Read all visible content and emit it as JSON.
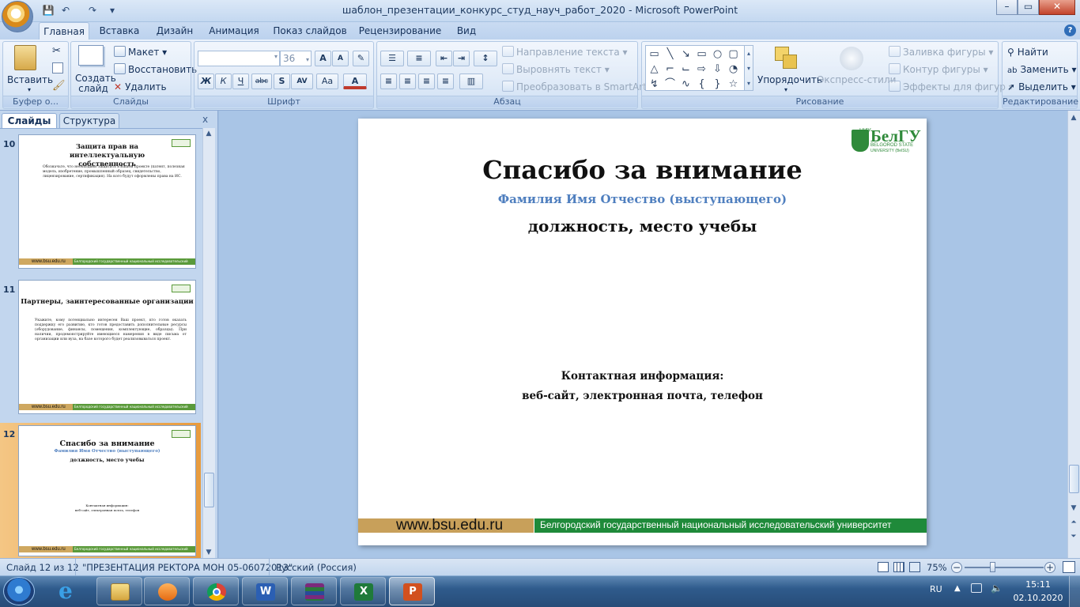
{
  "window": {
    "title": "шаблон_презентации_конкурс_студ_науч_работ_2020 - Microsoft PowerPoint",
    "minimize": "–",
    "maximize": "▭",
    "close": "✕"
  },
  "qat": {
    "save": "💾",
    "undo": "↶",
    "redo": "↷",
    "customize": "▾"
  },
  "tabs": [
    "Главная",
    "Вставка",
    "Дизайн",
    "Анимация",
    "Показ слайдов",
    "Рецензирование",
    "Вид"
  ],
  "help": "?",
  "ribbon": {
    "clipboard": {
      "label": "Буфер о...",
      "paste": "Вставить"
    },
    "slides": {
      "label": "Слайды",
      "new_slide": "Создать слайд",
      "layout": "Макет",
      "reset": "Восстановить",
      "delete": "Удалить"
    },
    "font": {
      "label": "Шрифт",
      "font_name": "",
      "font_size": "36",
      "grow": "A",
      "shrink": "A",
      "bold": "Ж",
      "italic": "К",
      "underline": "Ч",
      "strike": "abc",
      "shadow": "S",
      "spacing": "AV",
      "case": "Aa",
      "color": "A"
    },
    "paragraph": {
      "label": "Абзац",
      "text_direction": "Направление текста",
      "align_text": "Выровнять текст",
      "smartart": "Преобразовать в SmartArt"
    },
    "drawing": {
      "label": "Рисование",
      "arrange": "Упорядочить",
      "quick_styles": "Экспресс-стили",
      "fill": "Заливка фигуры",
      "outline": "Контур фигуры",
      "effects": "Эффекты для фигур"
    },
    "editing": {
      "label": "Редактирование",
      "find": "Найти",
      "replace": "Заменить",
      "select": "Выделить"
    }
  },
  "left_pane": {
    "tab_slides": "Слайды",
    "tab_outline": "Структура",
    "close": "x",
    "thumbnails": [
      {
        "number": "10",
        "title": "Защита прав на интеллектуальную собственность",
        "body": "Обозначьте, что необходимо защитить в Вашем проекте (патент, полезная модель, изобретение, промышленный образец, свидетельство, лицензирование, сертификация). На кого будут оформлены права на ИС.",
        "footer_url": "www.bsu.edu.ru",
        "footer_text": "Белгородский государственный национальный исследовательский университет"
      },
      {
        "number": "11",
        "title": "Партнеры, заинтересованные организации",
        "body": "Укажите, кому потенциально интересен Ваш проект, кто готов оказать поддержку его развитию, кто готов предоставить дополнительные ресурсы (оборудование, финансы, помещения, комплектующие, образцы). При наличии, продемонстрируйте имеющиеся намерения в виде письма от организации или вуза, на базе которого будет реализовываться проект.",
        "footer_url": "www.bsu.edu.ru",
        "footer_text": "Белгородский государственный национальный исследовательский университет"
      },
      {
        "number": "12",
        "title": "Спасибо за внимание",
        "subtitle": "Фамилия Имя Отчество (выступающего)",
        "position": "должность, место учебы",
        "contacts": "Контактная информация:",
        "contacts2": "веб-сайт, электронная почта, телефон",
        "footer_url": "www.bsu.edu.ru",
        "footer_text": "Белгородский государственный национальный исследовательский университет"
      }
    ]
  },
  "slide": {
    "logo_main": "БелГУ",
    "logo_small": "НИУ",
    "logo_en1": "BELGOROD STATE",
    "logo_en2": "UNIVERSITY (BelSU)",
    "title": "Спасибо за внимание",
    "subtitle": "Фамилия Имя Отчество (выступающего)",
    "position": "должность, место учебы",
    "contacts_label": "Контактная информация:",
    "contacts_items": "веб-сайт, электронная почта, телефон",
    "footer_url": "www.bsu.edu.ru",
    "footer_text": "Белгородский государственный национальный исследовательский университет"
  },
  "status": {
    "slide_info": "Слайд 12 из 12",
    "theme": "\"ПРЕЗЕНТАЦИЯ РЕКТОРА МОН 05-06072013\"",
    "language": "Русский (Россия)",
    "zoom": "75%",
    "zoom_out": "−",
    "zoom_in": "+"
  },
  "taskbar": {
    "lang": "RU",
    "time": "15:11",
    "date": "02.10.2020"
  },
  "colors": {
    "accent_green": "#1f8a3a",
    "footer_tan": "#c8a05a",
    "subtitle_blue": "#4f7fbf",
    "selection_orange": "#e9a84e"
  }
}
